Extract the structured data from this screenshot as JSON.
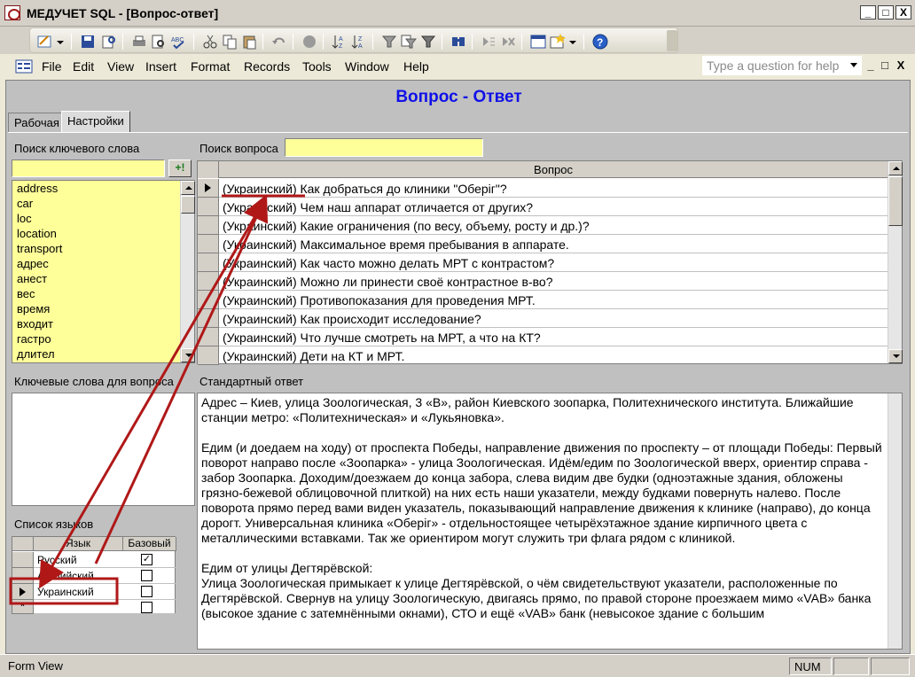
{
  "window": {
    "title": "МЕДУЧЕТ SQL - [Вопрос-ответ]",
    "minimize": "_",
    "maximize": "□",
    "close": "X"
  },
  "menu": {
    "items": [
      "File",
      "Edit",
      "View",
      "Insert",
      "Format",
      "Records",
      "Tools",
      "Window",
      "Help"
    ],
    "help_placeholder": "Type a question for help"
  },
  "form": {
    "title": "Вопрос - Ответ",
    "tabs": [
      "Рабочая",
      "Настройки"
    ],
    "active_tab": "Настройки"
  },
  "keyword_search": {
    "label": "Поиск ключевого слова",
    "value": "",
    "add_button": "+!",
    "items": [
      "address",
      "car",
      "loc",
      "location",
      "transport",
      "адрес",
      "анест",
      "вес",
      "время",
      "входит",
      "гастро",
      "длител"
    ]
  },
  "question_search": {
    "label": "Поиск вопроса",
    "value": ""
  },
  "question_grid": {
    "header": "Вопрос",
    "rows": [
      "(Украинский) Как добраться до клиники \"Оберіг\"?",
      "(Украинский) Чем наш аппарат отличается от других?",
      "(Украинский) Какие ограничения (по весу, объему, росту и др.)?",
      "(Украинский) Максимальное время пребывания в аппарате.",
      "(Украинский) Как часто можно делать МРТ с контрастом?",
      "(Украинский) Можно ли принести своё контрастное в-во?",
      "(Украинский) Противопоказания для проведения МРТ.",
      "(Украинский) Как происходит исследование?",
      "(Украинский) Что лучше смотреть на МРТ, а что на КТ?",
      "(Украинский) Дети на КТ и МРТ."
    ]
  },
  "keywords_for_question": {
    "label": "Ключевые слова для вопроса"
  },
  "standard_answer": {
    "label": "Стандартный ответ",
    "text": "Адрес – Киев, улица Зоологическая, 3 «В», район Киевского зоопарка, Политехнического института. Ближайшие станции метро: «Политехническая» и «Лукьяновка».\n\nЕдим (и доедаем на ходу) от проспекта Победы, направление движения по проспекту – от площади Победы: Первый поворот направо после «Зоопарка» - улица Зоологическая. Идём/едим по Зоологической вверх, ориентир справа - забор Зоопарка. Доходим/доезжаем до конца забора, слева видим две будки (одноэтажные здания, обложены грязно-бежевой облицовочной плиткой) на них есть наши указатели, между будками повернуть налево. После поворота прямо перед вами виден указатель, показывающий направление движения к клинике (направо), до конца дорогт. Универсальная клиника «Оберіг» - отдельностоящее четырёхэтажное здание кирпичного цвета с металлическими вставками. Так же ориентиром могут служить три флага рядом с клиникой.\n\nЕдим от улицы Дегтярёвской:\nУлица Зоологическая примыкает к улице Дегтярёвской, о чём свидетельствуют указатели, расположенные по Дегтярёвской. Свернув на улицу Зоологическую, двигаясь прямо, по правой стороне проезжаем мимо «VAB» банка (высокое здание с затемнёнными окнами), СТО и ещё «VAB» банк (невысокое здание с большим"
  },
  "languages": {
    "label": "Список языков",
    "col_language": "Язык",
    "col_base": "Базовый",
    "rows": [
      {
        "name": "Русский",
        "base": "✓"
      },
      {
        "name": "Английский",
        "base": ""
      },
      {
        "name": "Украинский",
        "base": ""
      },
      {
        "name": "",
        "base": ""
      }
    ],
    "new_row_marker": "*"
  },
  "statusbar": {
    "view": "Form View",
    "num": "NUM"
  },
  "colors": {
    "title": "#1010e8",
    "highlight_red": "#b01818",
    "yellow": "#ffff99"
  }
}
